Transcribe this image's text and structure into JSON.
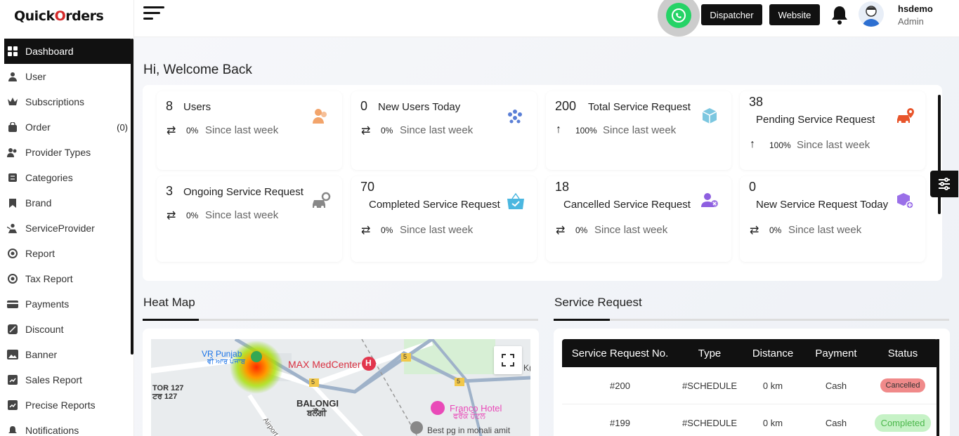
{
  "app": {
    "logo_prefix": "Quick",
    "logo_o": "O",
    "logo_suffix": "rders"
  },
  "sidebar": {
    "items": [
      {
        "label": "Dashboard",
        "icon": "dashboard-grid-icon",
        "active": true
      },
      {
        "label": "User",
        "icon": "user-icon"
      },
      {
        "label": "Subscriptions",
        "icon": "crown-icon"
      },
      {
        "label": "Order",
        "icon": "bag-icon",
        "count": "(0)"
      },
      {
        "label": "Provider Types",
        "icon": "users-icon"
      },
      {
        "label": "Categories",
        "icon": "list-icon"
      },
      {
        "label": "Brand",
        "icon": "bookmark-icon"
      },
      {
        "label": "ServiceProvider",
        "icon": "provider-icon"
      },
      {
        "label": "Report",
        "icon": "report-icon"
      },
      {
        "label": "Tax Report",
        "icon": "tax-report-icon"
      },
      {
        "label": "Payments",
        "icon": "payments-icon"
      },
      {
        "label": "Discount",
        "icon": "discount-icon"
      },
      {
        "label": "Banner",
        "icon": "image-icon"
      },
      {
        "label": "Sales Report",
        "icon": "sales-chart-icon"
      },
      {
        "label": "Precise Reports",
        "icon": "precise-chart-icon"
      },
      {
        "label": "Notifications",
        "icon": "bell-icon"
      }
    ]
  },
  "topbar": {
    "dispatcher_label": "Dispatcher",
    "website_label": "Website",
    "user_name": "hsdemo",
    "user_role": "Admin"
  },
  "dashboard": {
    "welcome": "Hi, Welcome Back",
    "cards": [
      {
        "num": "8",
        "label": "Users",
        "arrow": "⇄",
        "pct": "0%",
        "since": "Since last week",
        "icon": "users-icon",
        "color": "#f2a46b"
      },
      {
        "num": "0",
        "label": "New Users Today",
        "arrow": "⇄",
        "pct": "0%",
        "since": "Since last week",
        "icon": "group-icon",
        "color": "#5a7fd6"
      },
      {
        "num": "200",
        "label": "Total Service Request",
        "arrow": "↑",
        "pct": "100%",
        "since": "Since last week",
        "icon": "cube-icon",
        "color": "#7cc7e0"
      },
      {
        "num": "38",
        "label": "Pending Service Request",
        "arrow": "↑",
        "pct": "100%",
        "since": "Since last week",
        "icon": "car-pin-icon",
        "color": "#e8552b"
      },
      {
        "num": "3",
        "label": "Ongoing Service Request",
        "arrow": "⇄",
        "pct": "0%",
        "since": "Since last week",
        "icon": "car-gear-icon",
        "color": "#888888"
      },
      {
        "num": "70",
        "label": "Completed Service Request",
        "arrow": "⇄",
        "pct": "0%",
        "since": "Since last week",
        "icon": "basket-check-icon",
        "color": "#4bb7e0"
      },
      {
        "num": "18",
        "label": "Cancelled Service Request",
        "arrow": "⇄",
        "pct": "0%",
        "since": "Since last week",
        "icon": "users-cancel-icon",
        "color": "#8e5fe0"
      },
      {
        "num": "0",
        "label": "New Service Request Today",
        "arrow": "⇄",
        "pct": "0%",
        "since": "Since last week",
        "icon": "box-add-icon",
        "color": "#9a6fe8"
      }
    ]
  },
  "heatmap": {
    "title": "Heat Map",
    "labels": {
      "vr_punjab": "VR Punjab",
      "vr_punjab_local": "ਵੀ ਆਰ ਪੰਜਾਬ",
      "max": "MAX MedCenter",
      "tor": "TOR 127",
      "tor_local": "ਟਰ 127",
      "balongi": "BALONGI",
      "balongi_local": "ਬਲੌਂਗੀ",
      "franco": "Franco Hotel",
      "franco_local": "ਫਰੈਂਕੋ ਹੋਟਲ",
      "best_pg": "Best pg in mohali amit",
      "airport": "Airport",
      "road5": "5",
      "hospital_mark": "H",
      "edge_k": "K("
    }
  },
  "service_request": {
    "title": "Service Request",
    "columns": [
      "Service Request No.",
      "Type",
      "Distance",
      "Payment",
      "Status"
    ],
    "rows": [
      {
        "no": "#200",
        "type": "#SCHEDULE",
        "distance": "0 km",
        "payment": "Cash",
        "status": "Cancelled"
      },
      {
        "no": "#199",
        "type": "#SCHEDULE",
        "distance": "0 km",
        "payment": "Cash",
        "status": "Completed"
      }
    ]
  }
}
